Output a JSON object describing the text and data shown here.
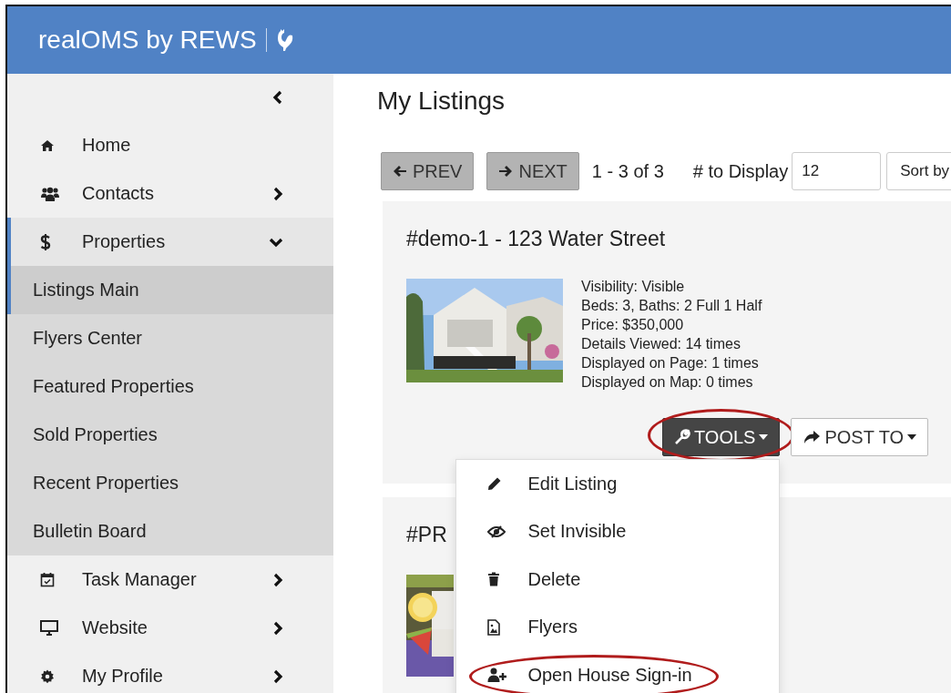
{
  "header": {
    "brand": "realOMS by REWS"
  },
  "sidebar": {
    "items": [
      {
        "label": "Home",
        "kind": "link",
        "selected": false
      },
      {
        "label": "Contacts",
        "kind": "group",
        "selected": false,
        "expanded": false
      },
      {
        "label": "Properties",
        "kind": "group",
        "selected": true,
        "expanded": true,
        "children": [
          {
            "label": "Listings Main",
            "selected": true
          },
          {
            "label": "Flyers Center",
            "selected": false
          },
          {
            "label": "Featured Properties",
            "selected": false
          },
          {
            "label": "Sold Properties",
            "selected": false
          },
          {
            "label": "Recent Properties",
            "selected": false
          },
          {
            "label": "Bulletin Board",
            "selected": false
          }
        ]
      },
      {
        "label": "Task Manager",
        "kind": "group",
        "selected": false,
        "expanded": false
      },
      {
        "label": "Website",
        "kind": "group",
        "selected": false,
        "expanded": false
      },
      {
        "label": "My Profile",
        "kind": "group",
        "selected": false,
        "expanded": false
      }
    ]
  },
  "page": {
    "title": "My Listings"
  },
  "toolbar": {
    "prev": "PREV",
    "next": "NEXT",
    "range": "1 - 3 of 3",
    "display_label": "# to Display",
    "display_value": "12",
    "sort_label": "Sort by"
  },
  "listings": [
    {
      "title": "#demo-1 - 123 Water Street",
      "details": [
        "Visibility: Visible",
        "Beds: 3, Baths: 2 Full 1 Half",
        "Price: $350,000",
        "Details Viewed: 14 times",
        "Displayed on Page: 1 times",
        "Displayed on Map: 0 times"
      ],
      "buttons": [
        {
          "label": "TOOLS",
          "kind": "tools",
          "highlighted": true
        },
        {
          "label": "POST TO",
          "kind": "post",
          "highlighted": false
        }
      ]
    },
    {
      "title": "#PR"
    }
  ],
  "tools_menu": {
    "items": [
      {
        "label": "Edit Listing",
        "highlighted": false
      },
      {
        "label": "Set Invisible",
        "highlighted": false
      },
      {
        "label": "Delete",
        "highlighted": false
      },
      {
        "label": "Flyers",
        "highlighted": false
      },
      {
        "label": "Open House Sign-in",
        "highlighted": true
      }
    ]
  }
}
